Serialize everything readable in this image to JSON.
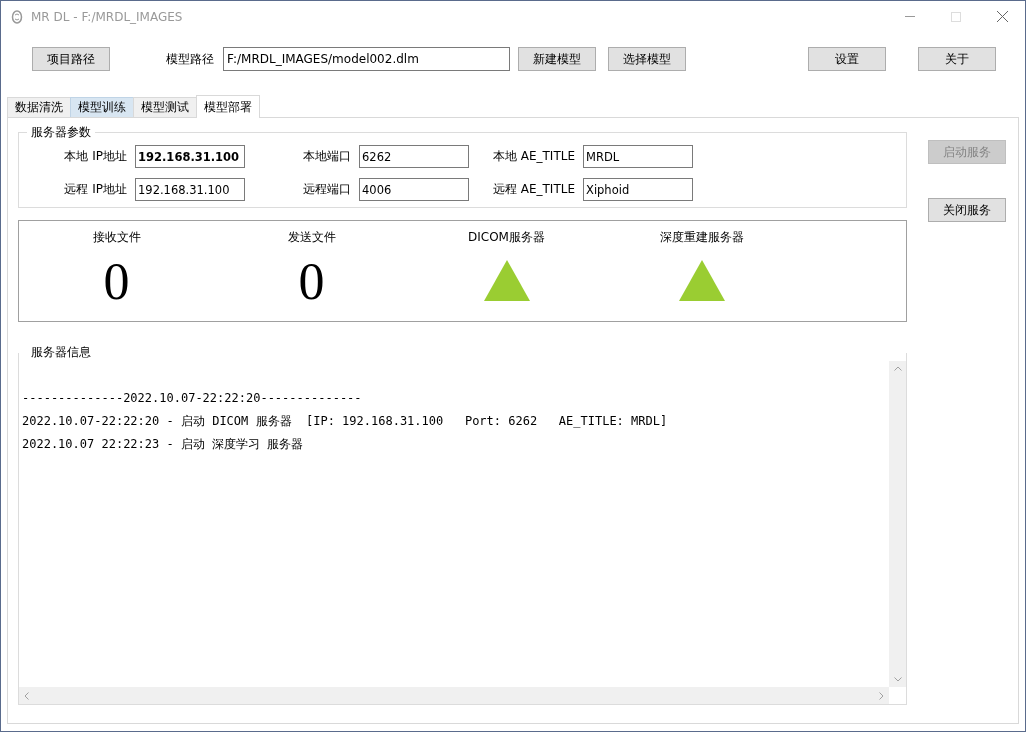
{
  "window": {
    "title": "MR DL - F:/MRDL_IMAGES",
    "active": false
  },
  "toolbar": {
    "project_button": "项目路径",
    "model_path_label": "模型路径",
    "model_path_value": "F:/MRDL_IMAGES/model002.dlm",
    "new_model_button": "新建模型",
    "select_model_button": "选择模型",
    "settings_button": "设置",
    "about_button": "关于"
  },
  "tabs": [
    {
      "label": "数据清洗",
      "selected": false,
      "hovered": false
    },
    {
      "label": "模型训练",
      "selected": false,
      "hovered": true
    },
    {
      "label": "模型测试",
      "selected": false,
      "hovered": false
    },
    {
      "label": "模型部署",
      "selected": true,
      "hovered": false
    }
  ],
  "server_params": {
    "title": "服务器参数",
    "fields": [
      {
        "label": "本地 IP地址",
        "value": "192.168.31.100",
        "bold": true
      },
      {
        "label": "本地端口",
        "value": "6262",
        "bold": false
      },
      {
        "label": "本地 AE_TITLE",
        "value": "MRDL",
        "bold": false
      },
      {
        "label": "远程 IP地址",
        "value": "192.168.31.100",
        "bold": false
      },
      {
        "label": "远程端口",
        "value": "4006",
        "bold": false
      },
      {
        "label": "远程 AE_TITLE",
        "value": "Xiphoid",
        "bold": false
      }
    ]
  },
  "side_buttons": [
    {
      "label": "启动服务",
      "disabled": true
    },
    {
      "label": "关闭服务",
      "disabled": false
    }
  ],
  "indicators": [
    {
      "kind": "count",
      "label": "接收文件",
      "value": "0"
    },
    {
      "kind": "count",
      "label": "发送文件",
      "value": "0"
    },
    {
      "kind": "status",
      "label": "DICOM服务器",
      "running": true
    },
    {
      "kind": "status",
      "label": "深度重建服务器",
      "running": true
    }
  ],
  "server_info": {
    "title": "服务器信息",
    "lines": [
      "--------------2022.10.07-22:22:20--------------",
      "2022.10.07-22:22:20 - 启动 DICOM 服务器  [IP: 192.168.31.100   Port: 6262   AE_TITLE: MRDL]",
      "2022.10.07 22:22:23 - 启动 深度学习 服务器"
    ]
  }
}
